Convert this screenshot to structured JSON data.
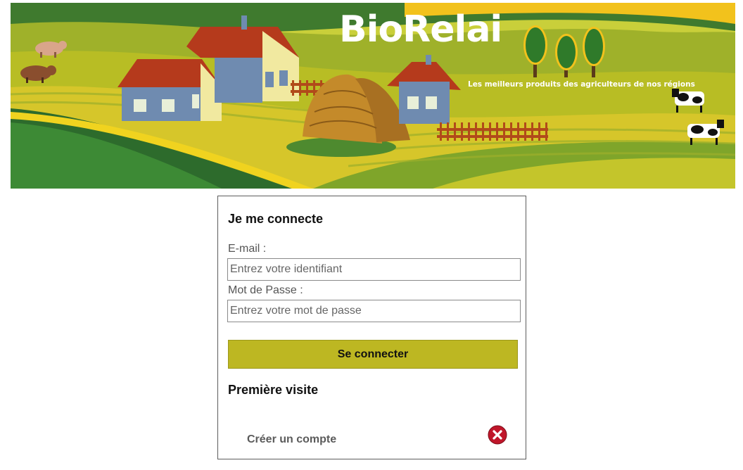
{
  "header": {
    "brand": "BioRelai",
    "tagline": "Les meilleurs produits des agriculteurs de nos régions"
  },
  "login": {
    "title": "Je me connecte",
    "email_label": "E-mail :",
    "email_placeholder": "Entrez votre identifiant",
    "email_value": "",
    "password_label": "Mot de Passe :",
    "password_placeholder": "Entrez votre mot de passe",
    "password_value": "",
    "submit_label": "Se connecter",
    "first_visit_title": "Première visite",
    "create_account_label": "Créer un compte",
    "close_icon": "close-icon"
  },
  "colors": {
    "accent": "#bdb722",
    "close": "#c0162a"
  }
}
